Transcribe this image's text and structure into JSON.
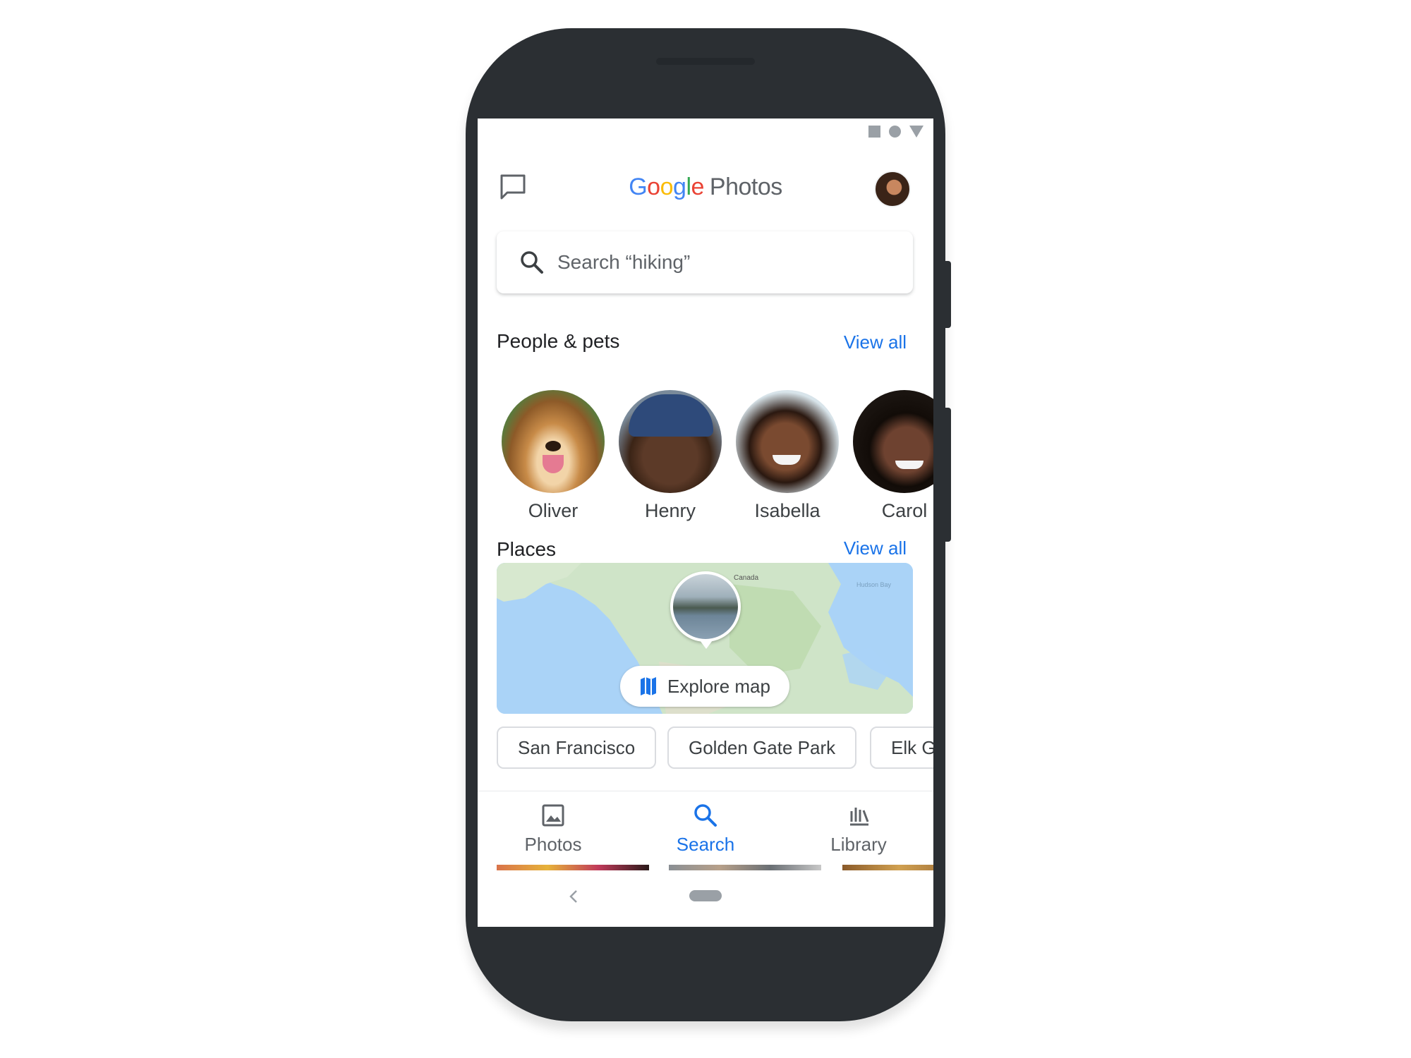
{
  "header": {
    "logo_letters": [
      "G",
      "o",
      "o",
      "g",
      "l",
      "e"
    ],
    "logo_product": "Photos",
    "icons": {
      "chat": "chat-bubble-icon",
      "avatar": "account-avatar"
    }
  },
  "status_bar": {
    "icons": [
      "square-icon",
      "circle-icon",
      "triangle-icon"
    ]
  },
  "search": {
    "placeholder": "Search “hiking”",
    "icon": "search-icon"
  },
  "people_section": {
    "title": "People & pets",
    "view_all": "View all",
    "people": [
      {
        "name": "Oliver"
      },
      {
        "name": "Henry"
      },
      {
        "name": "Isabella"
      },
      {
        "name": "Carol"
      }
    ]
  },
  "places_section": {
    "title": "Places",
    "view_all": "View all",
    "map": {
      "labels": [
        "Canada",
        "Hudson Bay"
      ],
      "explore_label": "Explore map",
      "explore_icon": "map-icon"
    },
    "chips": [
      "San Francisco",
      "Golden Gate Park",
      "Elk G"
    ]
  },
  "bottom_nav": {
    "items": [
      {
        "label": "Photos",
        "icon": "photo-icon",
        "active": false
      },
      {
        "label": "Search",
        "icon": "search-icon",
        "active": true
      },
      {
        "label": "Library",
        "icon": "library-icon",
        "active": false
      }
    ]
  },
  "colors": {
    "accent": "#1a73e8",
    "google_blue": "#4285f4",
    "google_red": "#ea4335",
    "google_yellow": "#fbbc05",
    "google_green": "#34a853",
    "phone_body": "#2b2f33",
    "text_secondary": "#5f6368"
  }
}
